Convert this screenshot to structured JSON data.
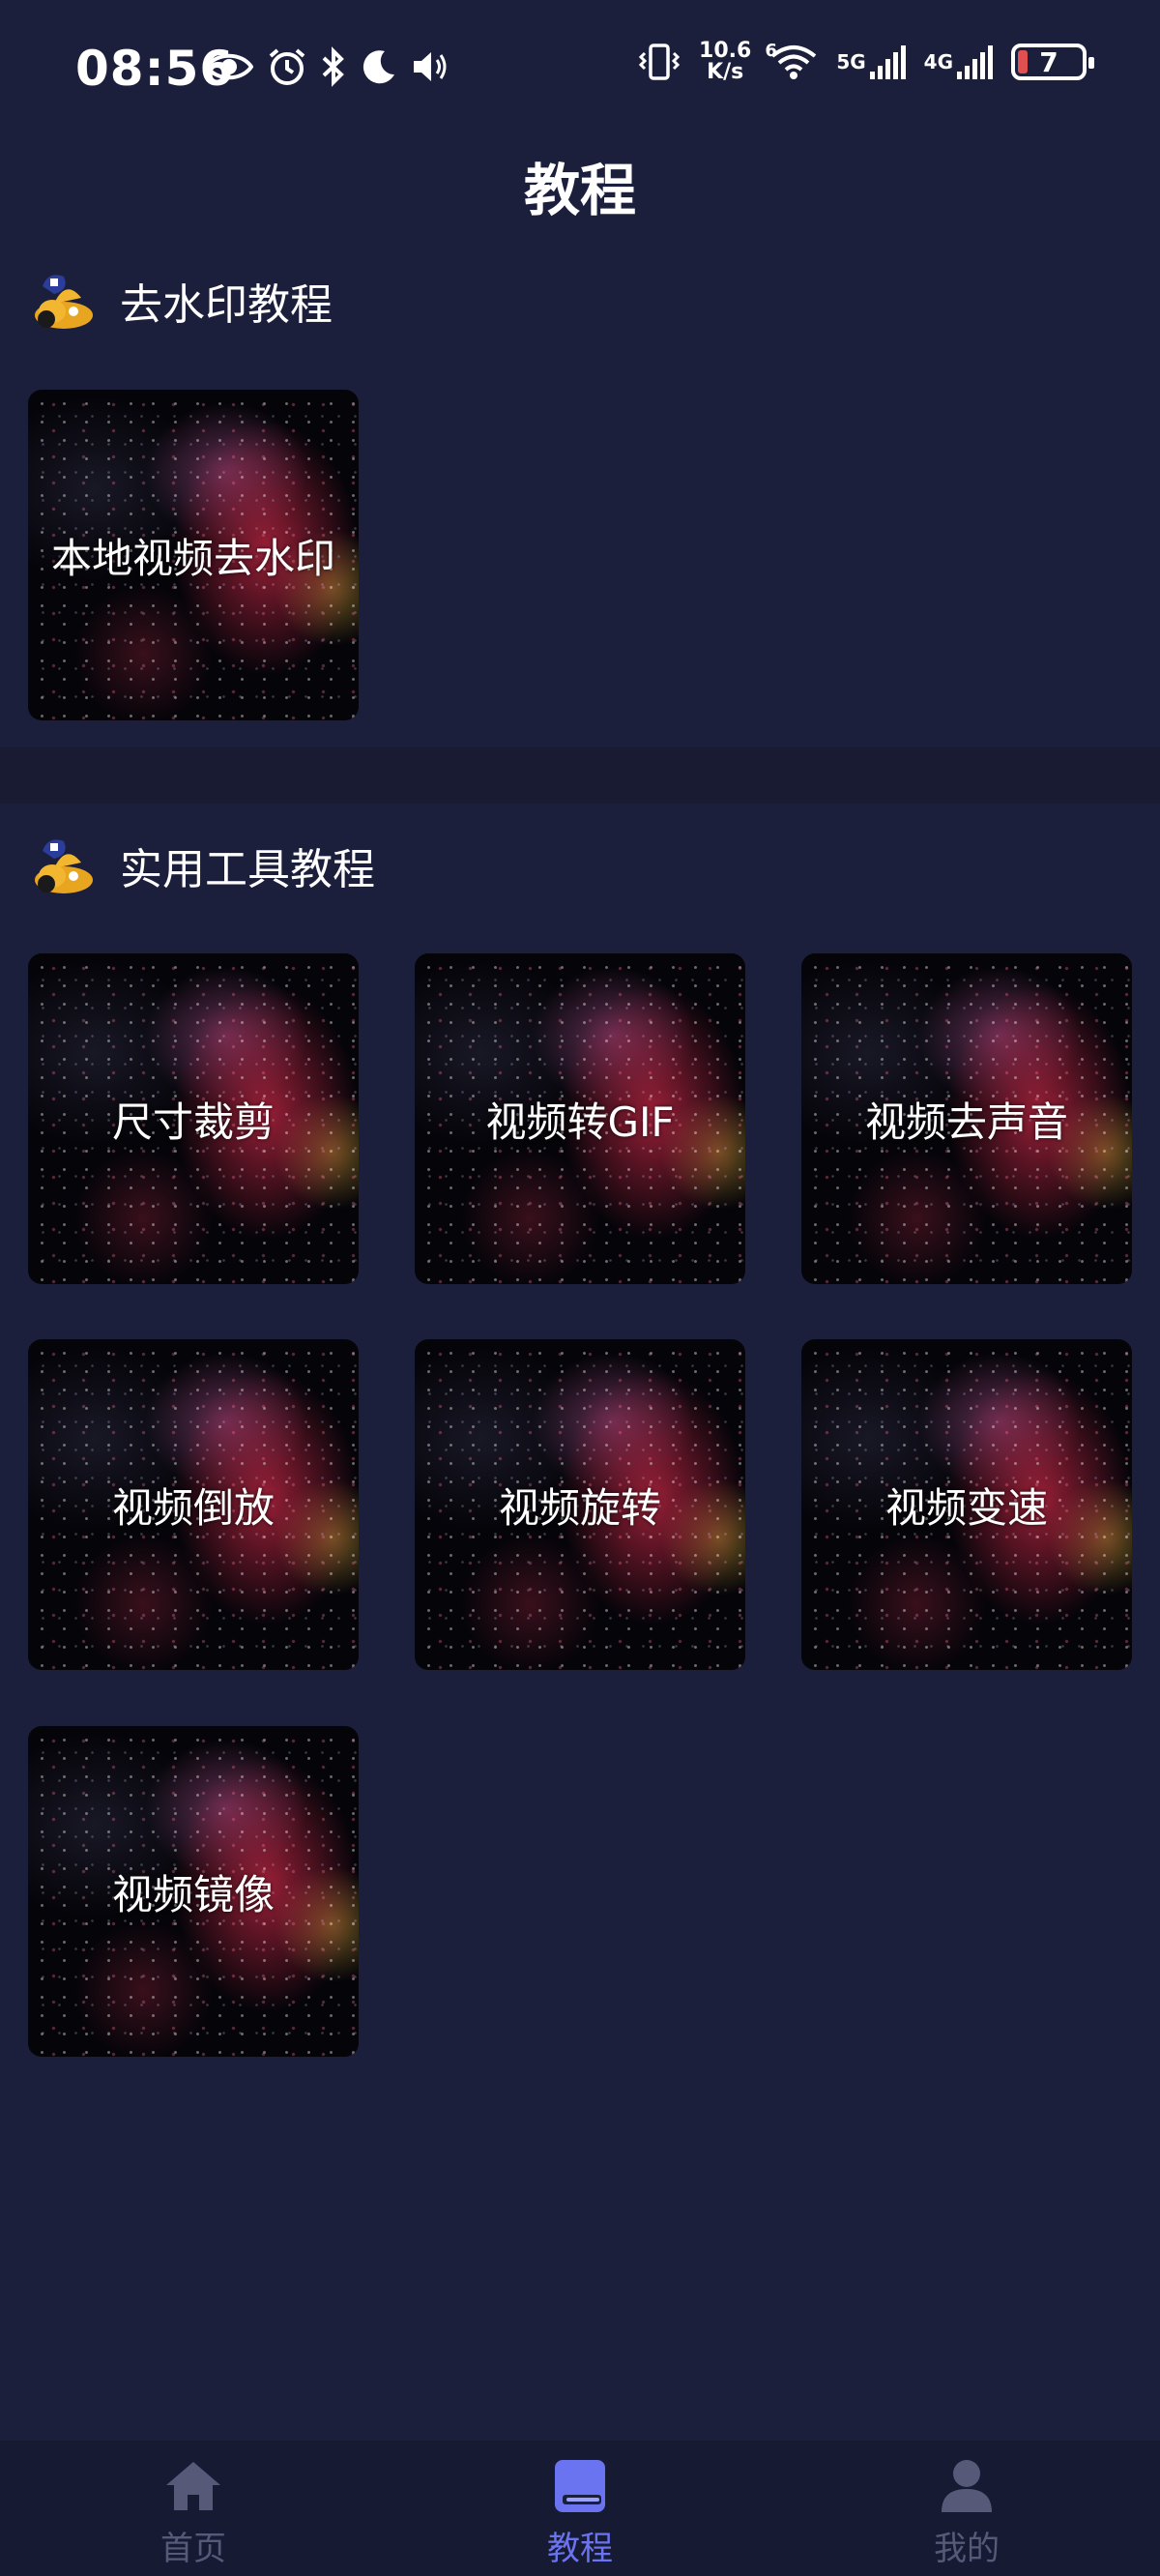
{
  "status_bar": {
    "time": "08:56",
    "net_speed_value": "10.6",
    "net_speed_unit": "K/s",
    "sim1_label": "5G",
    "sim2_label": "4G",
    "wifi_badge": "6",
    "battery_level": "7"
  },
  "page": {
    "title": "教程"
  },
  "sections": [
    {
      "title": "去水印教程",
      "items": [
        {
          "label": "本地视频去水印"
        }
      ]
    },
    {
      "title": "实用工具教程",
      "items": [
        {
          "label": "尺寸裁剪"
        },
        {
          "label": "视频转GIF"
        },
        {
          "label": "视频去声音"
        },
        {
          "label": "视频倒放"
        },
        {
          "label": "视频旋转"
        },
        {
          "label": "视频变速"
        },
        {
          "label": "视频镜像"
        }
      ]
    }
  ],
  "bottom_nav": {
    "items": [
      {
        "label": "首页",
        "icon": "home-icon",
        "active": false
      },
      {
        "label": "教程",
        "icon": "book-icon",
        "active": true
      },
      {
        "label": "我的",
        "icon": "profile-icon",
        "active": false
      }
    ]
  },
  "colors": {
    "background": "#1c1f3b",
    "nav_background": "#171a33",
    "nav_active": "#6a74f0",
    "nav_inactive": "#565a78"
  }
}
